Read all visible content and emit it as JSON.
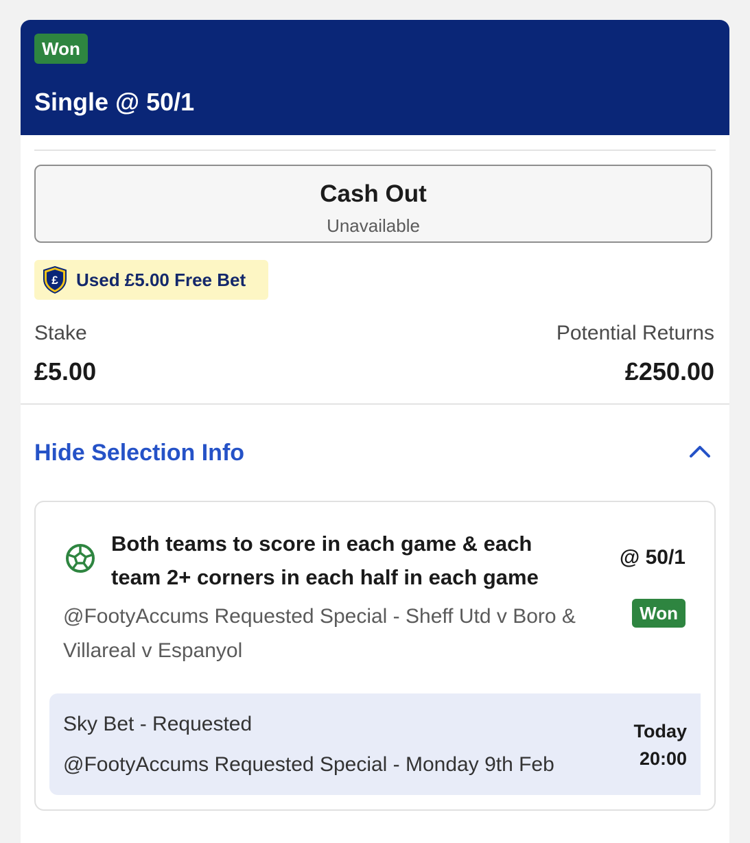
{
  "bet": {
    "status_badge": "Won",
    "title": "Single @ 50/1"
  },
  "cash_out": {
    "title": "Cash Out",
    "subtitle": "Unavailable"
  },
  "free_bet": {
    "icon": "pound-shield-icon",
    "text": "Used £5.00 Free Bet"
  },
  "stake": {
    "label": "Stake",
    "value": "£5.00"
  },
  "returns": {
    "label": "Potential Returns",
    "value": "£250.00"
  },
  "selection_toggle": {
    "label": "Hide Selection Info",
    "icon": "chevron-up-icon"
  },
  "selection": {
    "icon": "football-icon",
    "title": "Both teams to score in each game & each team 2+ corners in each half in each game",
    "odds": "@ 50/1",
    "market": "@FootyAccums Requested Special - Sheff Utd v Boro & Villareal v Espanyol",
    "status_badge": "Won",
    "event": {
      "line1": "Sky Bet - Requested",
      "line2": "@FootyAccums Requested Special - Monday 9th Feb",
      "day": "Today",
      "time": "20:00"
    }
  },
  "colors": {
    "header_bg": "#0a2677",
    "won_green": "#2e8540",
    "link_blue": "#2552c7",
    "free_bet_bg": "#fdf6c4",
    "event_bg": "#e8ecf8"
  }
}
